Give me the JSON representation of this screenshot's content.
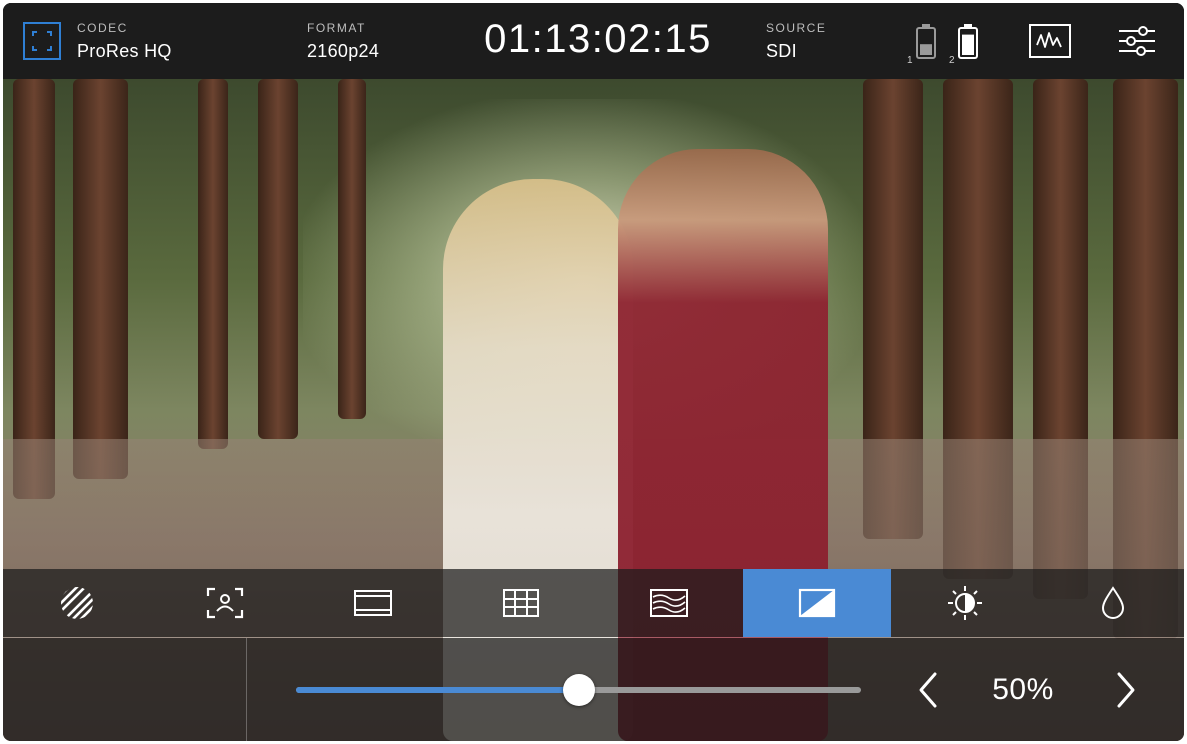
{
  "status_bar": {
    "codec": {
      "label": "CODEC",
      "value": "ProRes HQ"
    },
    "format": {
      "label": "FORMAT",
      "value": "2160p24"
    },
    "timecode": "01:13:02:15",
    "source": {
      "label": "SOURCE",
      "value": "SDI"
    },
    "batteries": [
      {
        "slot": "1",
        "level_fraction": 0.45
      },
      {
        "slot": "2",
        "level_fraction": 0.85
      }
    ],
    "buttons": [
      "waveform-scope-icon",
      "settings-sliders-icon"
    ]
  },
  "tools": [
    {
      "name": "zebra",
      "icon": "zebra-icon",
      "active": false
    },
    {
      "name": "focus-assist",
      "icon": "focus-assist-icon",
      "active": false
    },
    {
      "name": "frame-guides",
      "icon": "frame-guides-icon",
      "active": false
    },
    {
      "name": "grids",
      "icon": "grid-icon",
      "active": false
    },
    {
      "name": "false-color",
      "icon": "false-color-icon",
      "active": false
    },
    {
      "name": "lut",
      "icon": "lut-icon",
      "active": true
    },
    {
      "name": "brightness",
      "icon": "brightness-icon",
      "active": false
    },
    {
      "name": "saturation",
      "icon": "saturation-drop-icon",
      "active": false
    }
  ],
  "control": {
    "slider_level_percent": 50,
    "value_text": "50%"
  },
  "colors": {
    "accent": "#4a8ad4",
    "codec_icon": "#2f7fd4",
    "bar_bg": "#1c1c1c"
  }
}
